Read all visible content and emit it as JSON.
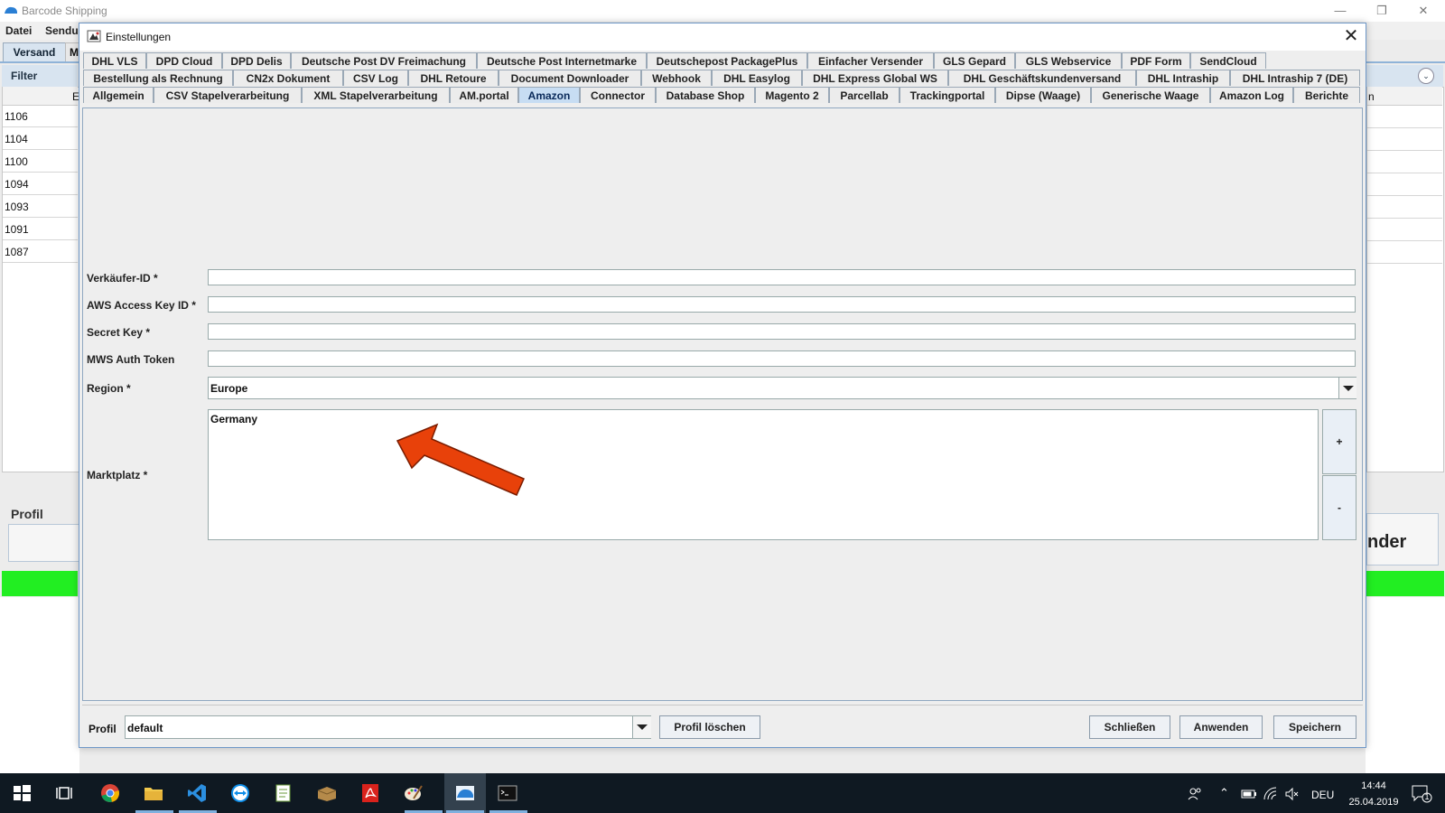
{
  "app": {
    "title": "Barcode Shipping",
    "window_controls": [
      "—",
      "❐",
      "✕"
    ],
    "menu": [
      "Datei",
      "Sendu"
    ],
    "tabs": [
      "Versand",
      "M"
    ],
    "filter_label": "Filter",
    "col_header_fragment": "E",
    "col_header_fragment_right": "n",
    "rows": [
      "1106",
      "1104",
      "1100",
      "1094",
      "1093",
      "1091",
      "1087"
    ],
    "profil_title": "Profil",
    "right_fragment": "nder"
  },
  "dialog": {
    "title": "Einstellungen",
    "close_label": "✕",
    "tab_rows": [
      [
        "DHL VLS",
        "DPD Cloud",
        "DPD Delis",
        "Deutsche Post DV Freimachung",
        "Deutsche Post Internetmarke",
        "Deutschepost PackagePlus",
        "Einfacher Versender",
        "GLS Gepard",
        "GLS Webservice",
        "PDF Form",
        "SendCloud"
      ],
      [
        "Bestellung als Rechnung",
        "CN2x Dokument",
        "CSV Log",
        "DHL Retoure",
        "Document Downloader",
        "Webhook",
        "DHL Easylog",
        "DHL Express Global WS",
        "DHL Geschäftskundenversand",
        "DHL Intraship",
        "DHL Intraship 7 (DE)"
      ],
      [
        "Allgemein",
        "CSV Stapelverarbeitung",
        "XML Stapelverarbeitung",
        "AM.portal",
        "Amazon",
        "Connector",
        "Database Shop",
        "Magento 2",
        "Parcellab",
        "Trackingportal",
        "Dipse (Waage)",
        "Generische Waage",
        "Amazon Log",
        "Berichte"
      ]
    ],
    "active_tab": "Amazon",
    "form": {
      "seller_id_label": "Verkäufer-ID *",
      "seller_id_value": "",
      "aws_key_label": "AWS Access Key ID *",
      "aws_key_value": "",
      "secret_key_label": "Secret Key *",
      "secret_key_value": "",
      "mws_token_label": "MWS Auth Token",
      "mws_token_value": "",
      "region_label": "Region *",
      "region_value": "Europe",
      "marketplace_label": "Marktplatz *",
      "marketplace_items": [
        "Germany"
      ],
      "add_label": "+",
      "remove_label": "-"
    },
    "annotation": {
      "arrow_color": "#e8410a"
    },
    "footer": {
      "profil_label": "Profil",
      "profil_value": "default",
      "delete_profile_label": "Profil löschen",
      "close_label": "Schließen",
      "apply_label": "Anwenden",
      "save_label": "Speichern"
    }
  },
  "taskbar": {
    "language": "DEU",
    "time": "14:44",
    "date": "25.04.2019",
    "notification_count": "1",
    "icons": [
      "windows-start-icon",
      "task-view-icon",
      "chrome-icon",
      "file-explorer-icon",
      "vscode-icon",
      "teamviewer-icon",
      "notepad-icon",
      "package-icon",
      "acrobat-icon",
      "paint-icon",
      "barcode-shipping-icon",
      "terminal-icon"
    ]
  },
  "colors": {
    "accent_tab": "#c7ddf3",
    "status_green": "#22ee22",
    "taskbar": "#0f1922"
  }
}
